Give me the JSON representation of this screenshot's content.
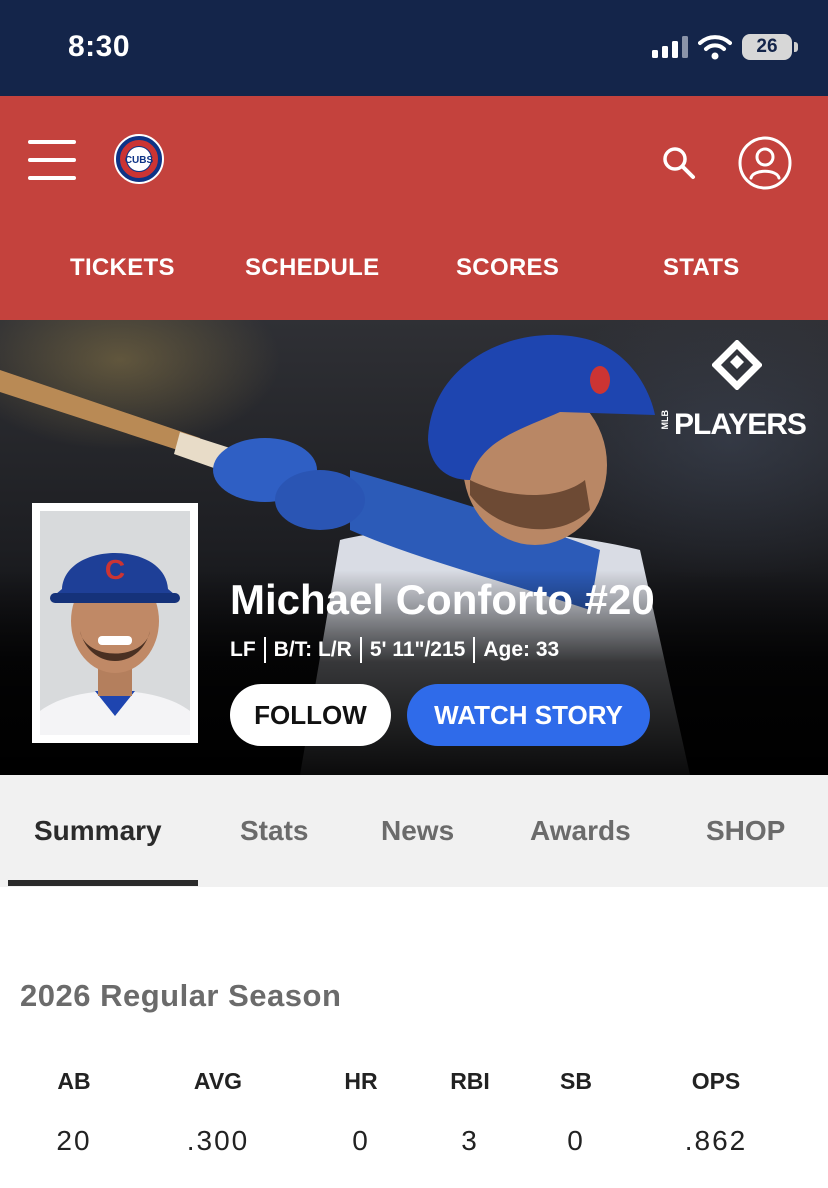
{
  "status_bar": {
    "time": "8:30",
    "icons": [
      "signal-icon",
      "wifi-icon",
      "battery-icon"
    ],
    "battery": "26"
  },
  "header": {
    "menu_icon": "hamburger-menu-icon",
    "logo": "cubs-logo",
    "logo_text": "CUBS",
    "search_icon": "search-icon",
    "account_icon": "account-icon",
    "background": "#c4423d",
    "nav": [
      {
        "label": "TICKETS"
      },
      {
        "label": "SCHEDULE"
      },
      {
        "label": "SCORES"
      },
      {
        "label": "STATS"
      }
    ]
  },
  "hero": {
    "badge": "PLAYERS",
    "badge_small": "MLB",
    "player_name": "Michael Conforto #20",
    "meta": {
      "position": "LF",
      "bats_throws": "B/T: L/R",
      "height_weight": "5' 11\"/215",
      "age": "Age: 33"
    },
    "follow_label": "FOLLOW",
    "watch_label": "WATCH STORY",
    "watch_color": "#2f6bea"
  },
  "tabs": {
    "items": [
      {
        "label": "Summary",
        "active": true
      },
      {
        "label": "Stats",
        "active": false
      },
      {
        "label": "News",
        "active": false
      },
      {
        "label": "Awards",
        "active": false
      },
      {
        "label": "SHOP",
        "active": false
      }
    ]
  },
  "season": {
    "title": "2026 Regular Season",
    "columns": [
      "AB",
      "AVG",
      "HR",
      "RBI",
      "SB",
      "OPS"
    ],
    "values": [
      "20",
      ".300",
      "0",
      "3",
      "0",
      ".862"
    ]
  }
}
